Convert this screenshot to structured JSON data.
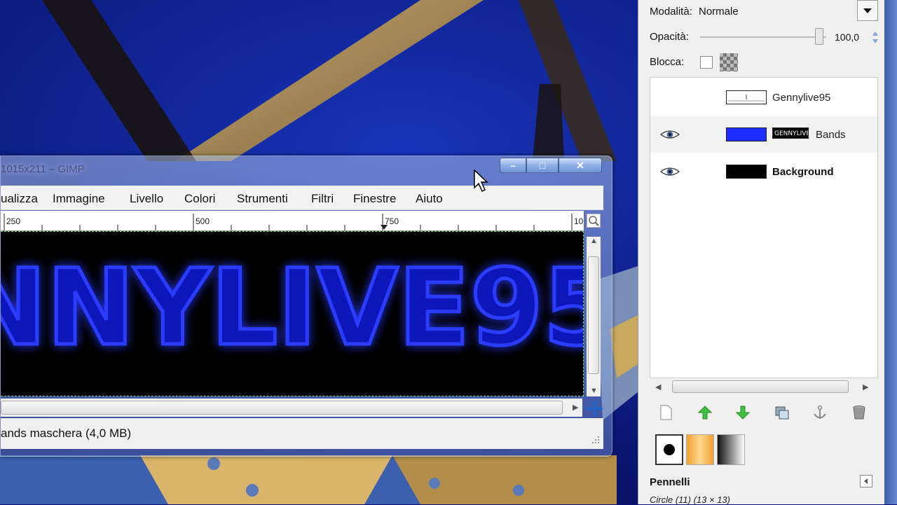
{
  "window": {
    "title": "1015x211 – GIMP",
    "controls": {
      "minimize": "–",
      "maximize": "□",
      "close": "✕"
    }
  },
  "menu": [
    "ualizza",
    "Immagine",
    "Livello",
    "Colori",
    "Strumenti",
    "Filtri",
    "Finestre",
    "Aiuto"
  ],
  "ruler": {
    "labels": [
      "250",
      "500",
      "750",
      "10"
    ]
  },
  "canvas": {
    "text": "NNYLIVE95",
    "glow_color": "#1e2cff",
    "background_color": "#000000"
  },
  "status": {
    "text": "ands maschera (4,0 MB)"
  },
  "layers_dock": {
    "mode_label": "Modalità:",
    "mode_value": "Normale",
    "opacity_label": "Opacità:",
    "opacity_value": "100,0",
    "lock_label": "Blocca:",
    "layers": [
      {
        "name": "Gennylive95",
        "visible": false,
        "selected": false,
        "bold": false,
        "thumb_color": "#ffffff"
      },
      {
        "name": "Bands",
        "visible": true,
        "selected": true,
        "bold": false,
        "thumb_color": "#1e2cff",
        "has_mask": true
      },
      {
        "name": "Background",
        "visible": true,
        "selected": false,
        "bold": true,
        "thumb_color": "#000000"
      }
    ],
    "buttons": [
      "new-layer-icon",
      "raise-layer-icon",
      "lower-layer-icon",
      "duplicate-layer-icon",
      "anchor-icon",
      "delete-icon"
    ]
  },
  "brushes": {
    "title": "Pennelli",
    "subtitle": "Circle (11) (13 × 13)"
  }
}
